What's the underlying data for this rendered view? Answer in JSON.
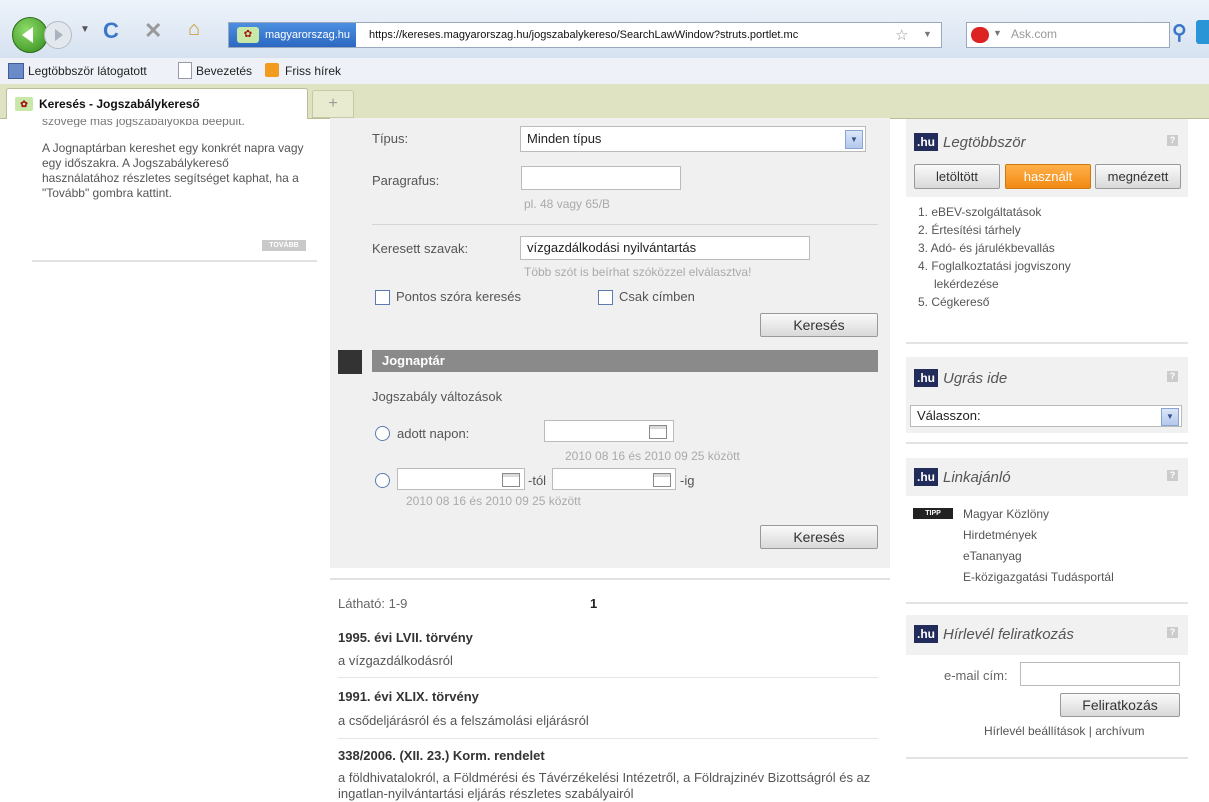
{
  "browser": {
    "url_site": "magyarorszag.hu",
    "url": "https://kereses.magyarorszag.hu/jogszabalykereso/SearchLawWindow?struts.portlet.mc",
    "search_placeholder": "Ask.com",
    "bookmarks": [
      "Legtöbbször látogatott",
      "Bevezetés",
      "Friss hírek"
    ],
    "tab_title": "Keresés - Jogszabálykereső"
  },
  "left": {
    "cut_text": "szövege más jogszabályokba beépült.",
    "paragraph": "A Jognaptárban kereshet egy konkrét napra vagy egy időszakra. A Jogszabálykereső használatához részletes segítséget kaphat, ha a \"Tovább\" gombra kattint.",
    "more_button": "TOVÁBB"
  },
  "form": {
    "type_label": "Típus:",
    "type_value": "Minden típus",
    "paragraph_label": "Paragrafus:",
    "paragraph_hint": "pl. 48 vagy 65/B",
    "search_label": "Keresett szavak:",
    "search_value": "vízgazdálkodási nyilvántartás",
    "search_hint": "Több szót is beírhat szóközzel elválasztva!",
    "exact_word": "Pontos szóra keresés",
    "title_only": "Csak címben",
    "search_button": "Keresés"
  },
  "calendar": {
    "heading": "Jognaptár",
    "subheading": "Jogszabály változások",
    "on_day_label": "adott napon:",
    "range_hint_1": "2010 08 16 és 2010 09 25 között",
    "from_suffix": "-tól",
    "to_suffix": "-ig",
    "range_hint_2": "2010 08 16 és 2010 09 25 között",
    "search_button": "Keresés"
  },
  "results": {
    "visible": "Látható: 1-9",
    "page": "1",
    "items": [
      {
        "title": "1995. évi LVII. törvény",
        "subtitle": "a vízgazdálkodásról"
      },
      {
        "title": "1991. évi XLIX. törvény",
        "subtitle": "a csődeljárásról és a felszámolási eljárásról"
      },
      {
        "title": "338/2006. (XII. 23.) Korm. rendelet",
        "subtitle": "a földhivatalokról, a Földmérési és Távérzékelési Intézetről, a Földrajzinév Bizottságról és az ingatlan-nyilvántartási eljárás részletes szabályairól"
      }
    ]
  },
  "widgets": {
    "logo": ".hu",
    "most": {
      "title": "Legtöbbször",
      "tabs": [
        "letöltött",
        "használt",
        "megnézett"
      ],
      "items": [
        "1. eBEV-szolgáltatások",
        "2. Értesítési tárhely",
        "3. Adó- és járulékbevallás",
        "4. Foglalkoztatási jogviszony",
        "lekérdezése",
        "5. Cégkereső"
      ]
    },
    "jump": {
      "title": "Ugrás ide",
      "select": "Válasszon:"
    },
    "links": {
      "title": "Linkajánló",
      "badge": "TIPP",
      "items": [
        "Magyar Közlöny",
        "Hirdetmények",
        "eTananyag",
        "E-közigazgatási Tudásportál"
      ]
    },
    "newsletter": {
      "title": "Hírlevél feliratkozás",
      "email_label": "e-mail cím:",
      "button": "Feliratkozás",
      "settings": "Hírlevél beállítások",
      "divider": "|",
      "archive": "archívum"
    }
  }
}
